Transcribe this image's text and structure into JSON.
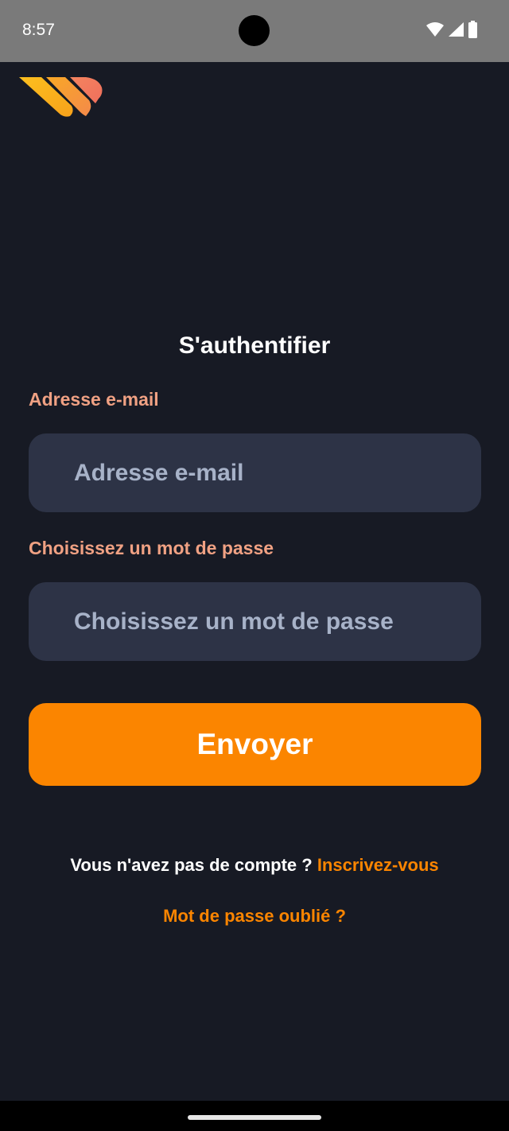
{
  "status_bar": {
    "time": "8:57",
    "icons": [
      "wifi-icon",
      "signal-icon",
      "battery-icon"
    ]
  },
  "logo": {
    "name": "app-logo",
    "colors": [
      "#fca311",
      "#f4845f"
    ]
  },
  "login": {
    "title": "S'authentifier",
    "email_label": "Adresse e-mail",
    "email_placeholder": "Adresse e-mail",
    "password_label": "Choisissez un mot de passe",
    "password_placeholder": "Choisissez un mot de passe",
    "submit_label": "Envoyer",
    "signup_prompt": "Vous n'avez pas de compte ? ",
    "signup_link": "Inscrivez-vous",
    "forgot_link": "Mot de passe oublié ?"
  },
  "colors": {
    "background": "#171a24",
    "input_background": "#2d3346",
    "accent": "#fb8500",
    "label": "#f0a183",
    "placeholder": "#a7b2c8"
  }
}
